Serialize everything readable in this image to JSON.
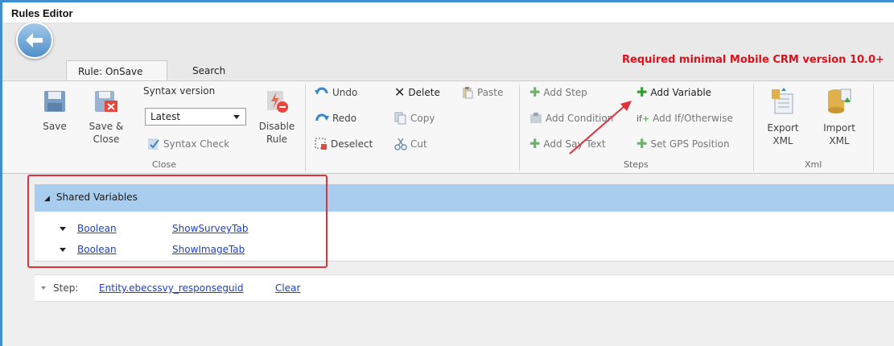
{
  "window": {
    "title": "Rules Editor"
  },
  "tabs": [
    {
      "label": "Rule: OnSave",
      "active": true
    },
    {
      "label": "Search",
      "active": false
    }
  ],
  "required_note": "Required minimal Mobile CRM version 10.0+",
  "ribbon": {
    "close_group": {
      "label": "Close",
      "save": "Save",
      "save_close": [
        "Save &",
        "Close"
      ],
      "syntax_version_label": "Syntax version",
      "syntax_version_value": "Latest",
      "syntax_check": "Syntax Check",
      "disable_rule": [
        "Disable",
        "Rule"
      ]
    },
    "edit_group": {
      "undo": "Undo",
      "redo": "Redo",
      "deselect": "Deselect",
      "delete": "Delete",
      "copy": "Copy",
      "cut": "Cut",
      "paste": "Paste"
    },
    "steps_group": {
      "label": "Steps",
      "add_step": "Add Step",
      "add_condition": "Add Condition",
      "add_say_text": "Add Say Text",
      "add_variable": "Add Variable",
      "add_if_otherwise": "Add If/Otherwise",
      "set_gps_position": "Set GPS Position"
    },
    "xml_group": {
      "label": "Xml",
      "export": [
        "Export",
        "XML"
      ],
      "import": [
        "Import",
        "XML"
      ]
    }
  },
  "shared_variables": {
    "header": "Shared Variables",
    "rows": [
      {
        "type": "Boolean",
        "name": "ShowSurveyTab"
      },
      {
        "type": "Boolean",
        "name": "ShowImageTab"
      }
    ]
  },
  "step": {
    "label": "Step:",
    "entity": "Entity.ebecssvy_responseguid",
    "clear": "Clear"
  },
  "colors": {
    "accent_blue": "#3e8ed0",
    "header_blue": "#a9cdee",
    "required_red": "#e0101a",
    "highlight_red": "#e0303a",
    "link_blue": "#1a3fd1",
    "add_green": "#3fa53a"
  }
}
